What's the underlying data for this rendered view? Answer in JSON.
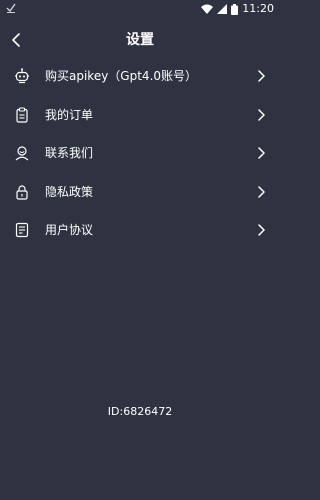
{
  "status_bar": {
    "time": "11:20",
    "left_icon": "check-notification-icon",
    "right_icons": [
      "wifi-icon",
      "signal-icon",
      "battery-icon"
    ]
  },
  "header": {
    "title": "设置",
    "back_icon": "chevron-left-icon"
  },
  "menu": {
    "items": [
      {
        "label": "购买apikey（Gpt4.0账号）",
        "icon": "robot-icon"
      },
      {
        "label": "我的订单",
        "icon": "clipboard-icon"
      },
      {
        "label": "联系我们",
        "icon": "person-icon"
      },
      {
        "label": "隐私政策",
        "icon": "lock-icon"
      },
      {
        "label": "用户协议",
        "icon": "document-icon"
      }
    ],
    "chevron_icon": "chevron-right-icon"
  },
  "footer": {
    "user_id": "ID:6826472"
  }
}
